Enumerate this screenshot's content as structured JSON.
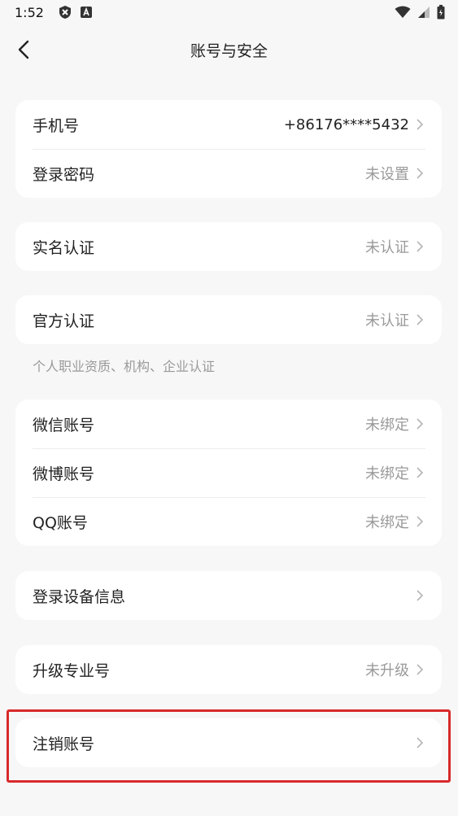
{
  "status": {
    "time": "1:52"
  },
  "nav": {
    "title": "账号与安全"
  },
  "sections": {
    "phone": {
      "label": "手机号",
      "value": "+86176****5432"
    },
    "password": {
      "label": "登录密码",
      "value": "未设置"
    },
    "realname": {
      "label": "实名认证",
      "value": "未认证"
    },
    "official": {
      "label": "官方认证",
      "value": "未认证"
    },
    "official_hint": "个人职业资质、机构、企业认证",
    "wechat": {
      "label": "微信账号",
      "value": "未绑定"
    },
    "weibo": {
      "label": "微博账号",
      "value": "未绑定"
    },
    "qq": {
      "label": "QQ账号",
      "value": "未绑定"
    },
    "devices": {
      "label": "登录设备信息"
    },
    "pro": {
      "label": "升级专业号",
      "value": "未升级"
    },
    "cancel": {
      "label": "注销账号"
    }
  },
  "colors": {
    "highlight": "#d8292b",
    "background": "#f7f7f7"
  }
}
